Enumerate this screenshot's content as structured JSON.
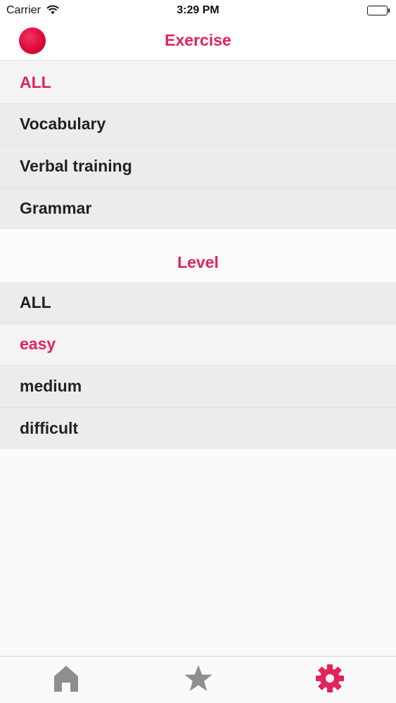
{
  "status_bar": {
    "carrier": "Carrier",
    "time": "3:29 PM"
  },
  "nav": {
    "title": "Exercise"
  },
  "exercise": {
    "items": [
      {
        "label": "ALL",
        "selected": true
      },
      {
        "label": "Vocabulary",
        "selected": false
      },
      {
        "label": "Verbal training",
        "selected": false
      },
      {
        "label": "Grammar",
        "selected": false
      }
    ]
  },
  "level": {
    "title": "Level",
    "items": [
      {
        "label": "ALL",
        "selected": false
      },
      {
        "label": "easy",
        "selected": true
      },
      {
        "label": "medium",
        "selected": false
      },
      {
        "label": "difficult",
        "selected": false
      }
    ]
  },
  "tab_bar": {
    "tabs": [
      {
        "icon": "home-icon",
        "active": false
      },
      {
        "icon": "star-icon",
        "active": false
      },
      {
        "icon": "gear-icon",
        "active": true
      }
    ]
  },
  "colors": {
    "accent": "#e3235a",
    "inactive_icon": "#8e8e8e",
    "row_bg": "#ececec"
  }
}
